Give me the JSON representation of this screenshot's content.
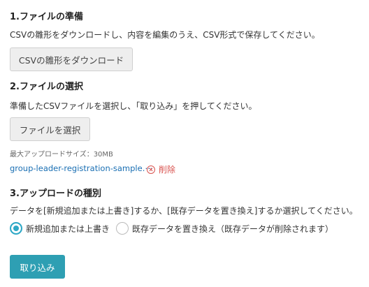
{
  "section1": {
    "heading": "1.ファイルの準備",
    "description": "CSVの雛形をダウンロードし、内容を編集のうえ、CSV形式で保存してください。",
    "download_button": "CSVの雛形をダウンロード"
  },
  "section2": {
    "heading": "2.ファイルの選択",
    "description": "準備したCSVファイルを選択し、「取り込み」を押してください。",
    "select_button": "ファイルを選択",
    "max_size_note": "最大アップロードサイズ：30MB",
    "selected_file": "group-leader-registration-sample.⋯",
    "delete_label": "削除",
    "delete_icon": "circle-x-icon"
  },
  "section3": {
    "heading": "3.アップロードの種別",
    "description": "データを[新規追加または上書き]するか、[既存データを置き換え]するか選択してください。",
    "options": [
      {
        "label": "新規追加または上書き",
        "checked": true
      },
      {
        "label": "既存データを置き換え（既存データが削除されます）",
        "checked": false
      }
    ]
  },
  "submit_button": "取り込み",
  "colors": {
    "accent": "#2e9fb3",
    "radio_checked": "#2ea8c6",
    "link": "#1a6fb3",
    "danger": "#d9534f"
  }
}
